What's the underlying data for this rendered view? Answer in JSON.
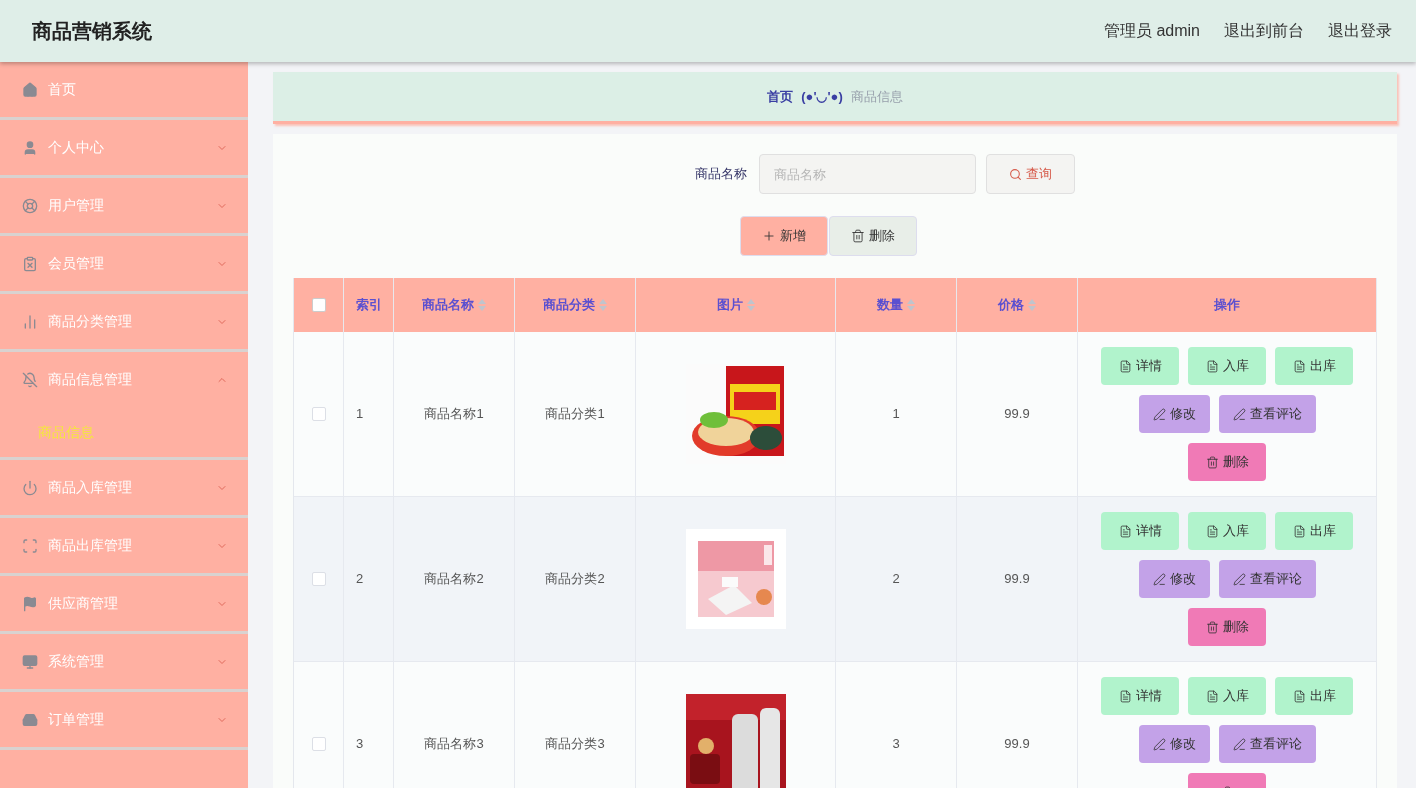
{
  "header": {
    "title": "商品营销系统",
    "links": [
      "管理员 admin",
      "退出到前台",
      "退出登录"
    ]
  },
  "sidebar": {
    "items": [
      {
        "label": "首页",
        "kind": "link"
      },
      {
        "label": "个人中心",
        "kind": "menu",
        "expanded": false
      },
      {
        "label": "用户管理",
        "kind": "menu",
        "expanded": false
      },
      {
        "label": "会员管理",
        "kind": "menu",
        "expanded": false
      },
      {
        "label": "商品分类管理",
        "kind": "menu",
        "expanded": false
      },
      {
        "label": "商品信息管理",
        "kind": "menu",
        "expanded": true,
        "children": [
          {
            "label": "商品信息",
            "selected": true
          }
        ]
      },
      {
        "label": "商品入库管理",
        "kind": "menu",
        "expanded": false
      },
      {
        "label": "商品出库管理",
        "kind": "menu",
        "expanded": false
      },
      {
        "label": "供应商管理",
        "kind": "menu",
        "expanded": false
      },
      {
        "label": "系统管理",
        "kind": "menu",
        "expanded": false
      },
      {
        "label": "订单管理",
        "kind": "menu",
        "expanded": false
      }
    ]
  },
  "breadcrumb": {
    "home": "首页",
    "separator": "(●'◡'●)",
    "current": "商品信息"
  },
  "search": {
    "label": "商品名称",
    "placeholder": "商品名称",
    "button": "查询"
  },
  "toolbar": [
    {
      "label": "新增",
      "kind": "add"
    },
    {
      "label": "删除",
      "kind": "delete"
    }
  ],
  "table": {
    "select_all": {
      "checked": false
    },
    "columns": [
      {
        "label": "索引",
        "sortable": false
      },
      {
        "label": "商品名称",
        "sortable": true
      },
      {
        "label": "商品分类",
        "sortable": true
      },
      {
        "label": "图片",
        "sortable": true
      },
      {
        "label": "数量",
        "sortable": true
      },
      {
        "label": "价格",
        "sortable": true
      },
      {
        "label": "操作",
        "sortable": false
      }
    ],
    "rows": [
      {
        "checked": false,
        "index": "1",
        "name": "商品名称1",
        "category": "商品分类1",
        "image": {
          "kind": "picture"
        },
        "quantity": "1",
        "price": "99.9",
        "actions": [
          {
            "label": "详情",
            "kind": "view"
          },
          {
            "label": "入库",
            "kind": "view"
          },
          {
            "label": "出库",
            "kind": "view"
          },
          {
            "label": "修改",
            "kind": "edit"
          },
          {
            "label": "查看评论",
            "kind": "edit"
          },
          {
            "label": "删除",
            "kind": "delete"
          }
        ]
      },
      {
        "checked": false,
        "index": "2",
        "name": "商品名称2",
        "category": "商品分类2",
        "image": {
          "kind": "picture"
        },
        "quantity": "2",
        "price": "99.9",
        "actions": [
          {
            "label": "详情",
            "kind": "view"
          },
          {
            "label": "入库",
            "kind": "view"
          },
          {
            "label": "出库",
            "kind": "view"
          },
          {
            "label": "修改",
            "kind": "edit"
          },
          {
            "label": "查看评论",
            "kind": "edit"
          },
          {
            "label": "删除",
            "kind": "delete"
          }
        ]
      },
      {
        "checked": false,
        "index": "3",
        "name": "商品名称3",
        "category": "商品分类3",
        "image": {
          "kind": "picture"
        },
        "quantity": "3",
        "price": "99.9",
        "actions": [
          {
            "label": "详情",
            "kind": "view"
          },
          {
            "label": "入库",
            "kind": "view"
          },
          {
            "label": "出库",
            "kind": "view"
          },
          {
            "label": "修改",
            "kind": "edit"
          },
          {
            "label": "查看评论",
            "kind": "edit"
          },
          {
            "kind": "delete"
          }
        ]
      }
    ]
  }
}
